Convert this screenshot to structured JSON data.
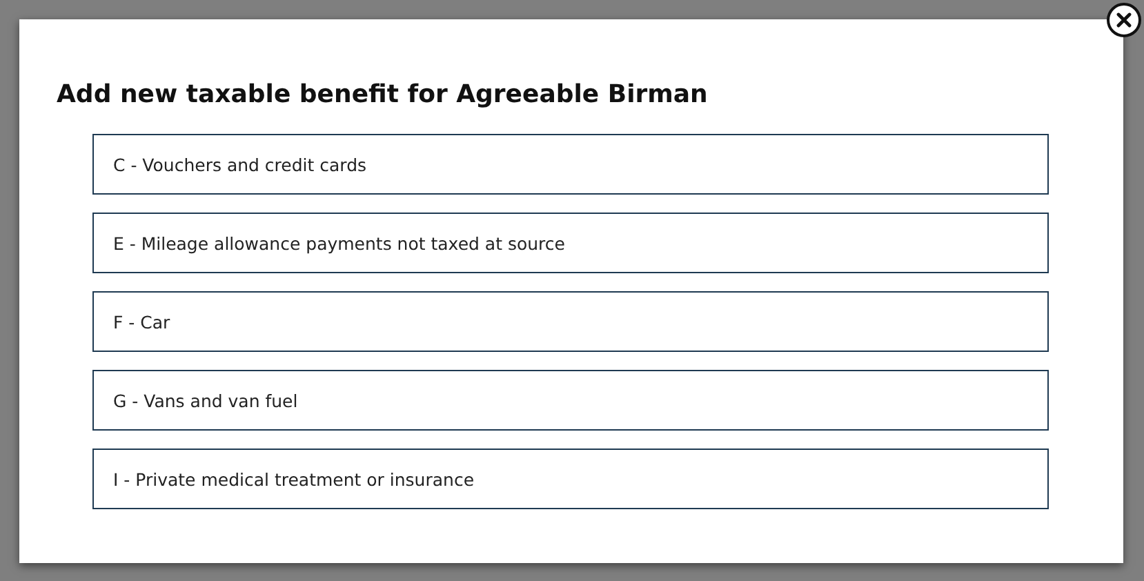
{
  "dialog": {
    "title": "Add new taxable benefit for Agreeable Birman",
    "options": [
      {
        "label": "C - Vouchers and credit cards"
      },
      {
        "label": "E - Mileage allowance payments not taxed at source"
      },
      {
        "label": "F - Car"
      },
      {
        "label": "G - Vans and van fuel"
      },
      {
        "label": "I - Private medical treatment or insurance"
      }
    ]
  }
}
